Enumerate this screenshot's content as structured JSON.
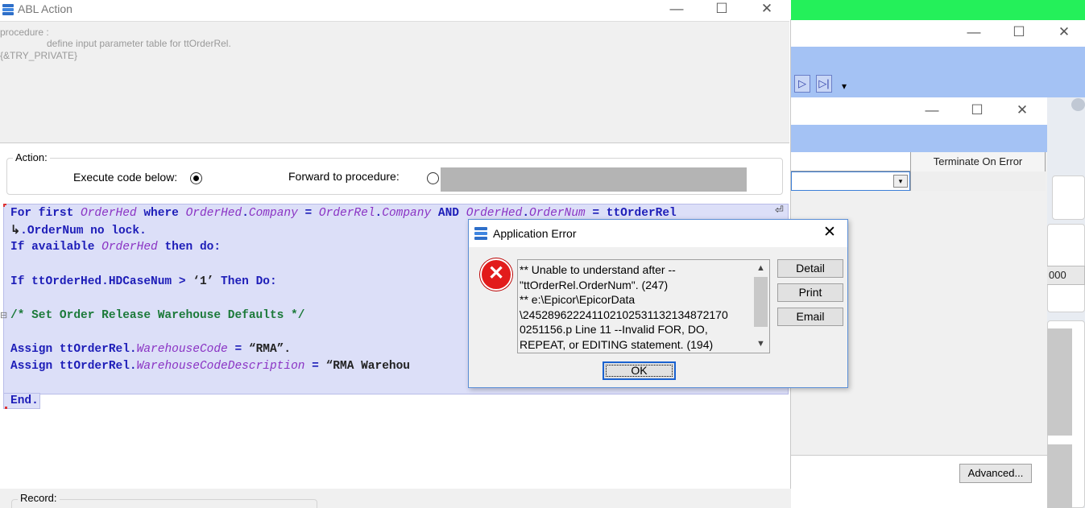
{
  "background": {
    "window1": {
      "min": "—",
      "max": "☐",
      "close": "✕"
    },
    "nav": {
      "next": "▷",
      "last": "▷|",
      "dropdown": "▾"
    },
    "window2": {
      "min": "—",
      "max": "☐",
      "close": "✕"
    },
    "grid": {
      "column_header": "Terminate On Error"
    },
    "side_value": "000",
    "advanced_button": "Advanced..."
  },
  "main": {
    "title": "ABL Action",
    "controls": {
      "min": "—",
      "max": "☐",
      "close": "✕"
    },
    "procedure": {
      "line1": "procedure :",
      "line2": "define input parameter table for ttOrderRel.",
      "line3": "{&TRY_PRIVATE}"
    },
    "action": {
      "legend": "Action:",
      "execute_label": "Execute code below:",
      "execute_selected": true,
      "forward_label": "Forward to procedure:",
      "forward_selected": false,
      "forward_value": ""
    },
    "record": {
      "legend": "Record:"
    }
  },
  "code": {
    "l1": [
      {
        "t": "For first ",
        "c": "kw"
      },
      {
        "t": "OrderHed",
        "c": "vr"
      },
      {
        "t": " where ",
        "c": "kw"
      },
      {
        "t": "OrderHed",
        "c": "vr"
      },
      {
        "t": ".",
        "c": "kw"
      },
      {
        "t": "Company",
        "c": "vr"
      },
      {
        "t": " = ",
        "c": "kw"
      },
      {
        "t": "OrderRel",
        "c": "vr"
      },
      {
        "t": ".",
        "c": "kw"
      },
      {
        "t": "Company",
        "c": "vr"
      },
      {
        "t": " AND ",
        "c": "kw"
      },
      {
        "t": "OrderHed",
        "c": "vr"
      },
      {
        "t": ".",
        "c": "kw"
      },
      {
        "t": "OrderNum",
        "c": "vr"
      },
      {
        "t": " = ttOrderRel",
        "c": "kw"
      }
    ],
    "l2": [
      {
        "t": "↳",
        "c": "st"
      },
      {
        "t": ".OrderNum no lock.",
        "c": "kw"
      }
    ],
    "l3": [
      {
        "t": "If available ",
        "c": "kw"
      },
      {
        "t": "OrderHed",
        "c": "vr"
      },
      {
        "t": " then do:",
        "c": "kw"
      }
    ],
    "l4": [
      {
        "t": "If ttOrderHed.HDCaseNum > ",
        "c": "kw"
      },
      {
        "t": "‘1’",
        "c": "st"
      },
      {
        "t": " Then Do:",
        "c": "kw"
      }
    ],
    "l5": [
      {
        "t": "/* Set Order Release Warehouse Defaults */",
        "c": "cm"
      }
    ],
    "l6": [
      {
        "t": "Assign ttOrderRel.",
        "c": "kw"
      },
      {
        "t": "WarehouseCode",
        "c": "vr"
      },
      {
        "t": " = ",
        "c": "kw"
      },
      {
        "t": "“RMA”.",
        "c": "st"
      }
    ],
    "l7": [
      {
        "t": "Assign ttOrderRel.",
        "c": "kw"
      },
      {
        "t": "WarehouseCodeDescription",
        "c": "vr"
      },
      {
        "t": " = ",
        "c": "kw"
      },
      {
        "t": "“RMA Warehou",
        "c": "st"
      }
    ],
    "l8": [
      {
        "t": "End.",
        "c": "kw"
      }
    ],
    "wrap_marker": "⏎",
    "fold_marker": "⊟"
  },
  "dialog": {
    "title": "Application Error",
    "close": "✕",
    "error_glyph": "✕",
    "message": "** Unable to understand after --\n\"ttOrderRel.OrderNum\". (247)\n** e:\\Epicor\\EpicorData\n\\245289622241102102531132134872170\n0251156.p Line 11 --Invalid FOR, DO,\nREPEAT, or EDITING statement. (194)",
    "scroll_up": "▲",
    "scroll_down": "▼",
    "buttons": {
      "detail": "Detail",
      "print": "Print",
      "email": "Email",
      "ok": "OK"
    }
  }
}
